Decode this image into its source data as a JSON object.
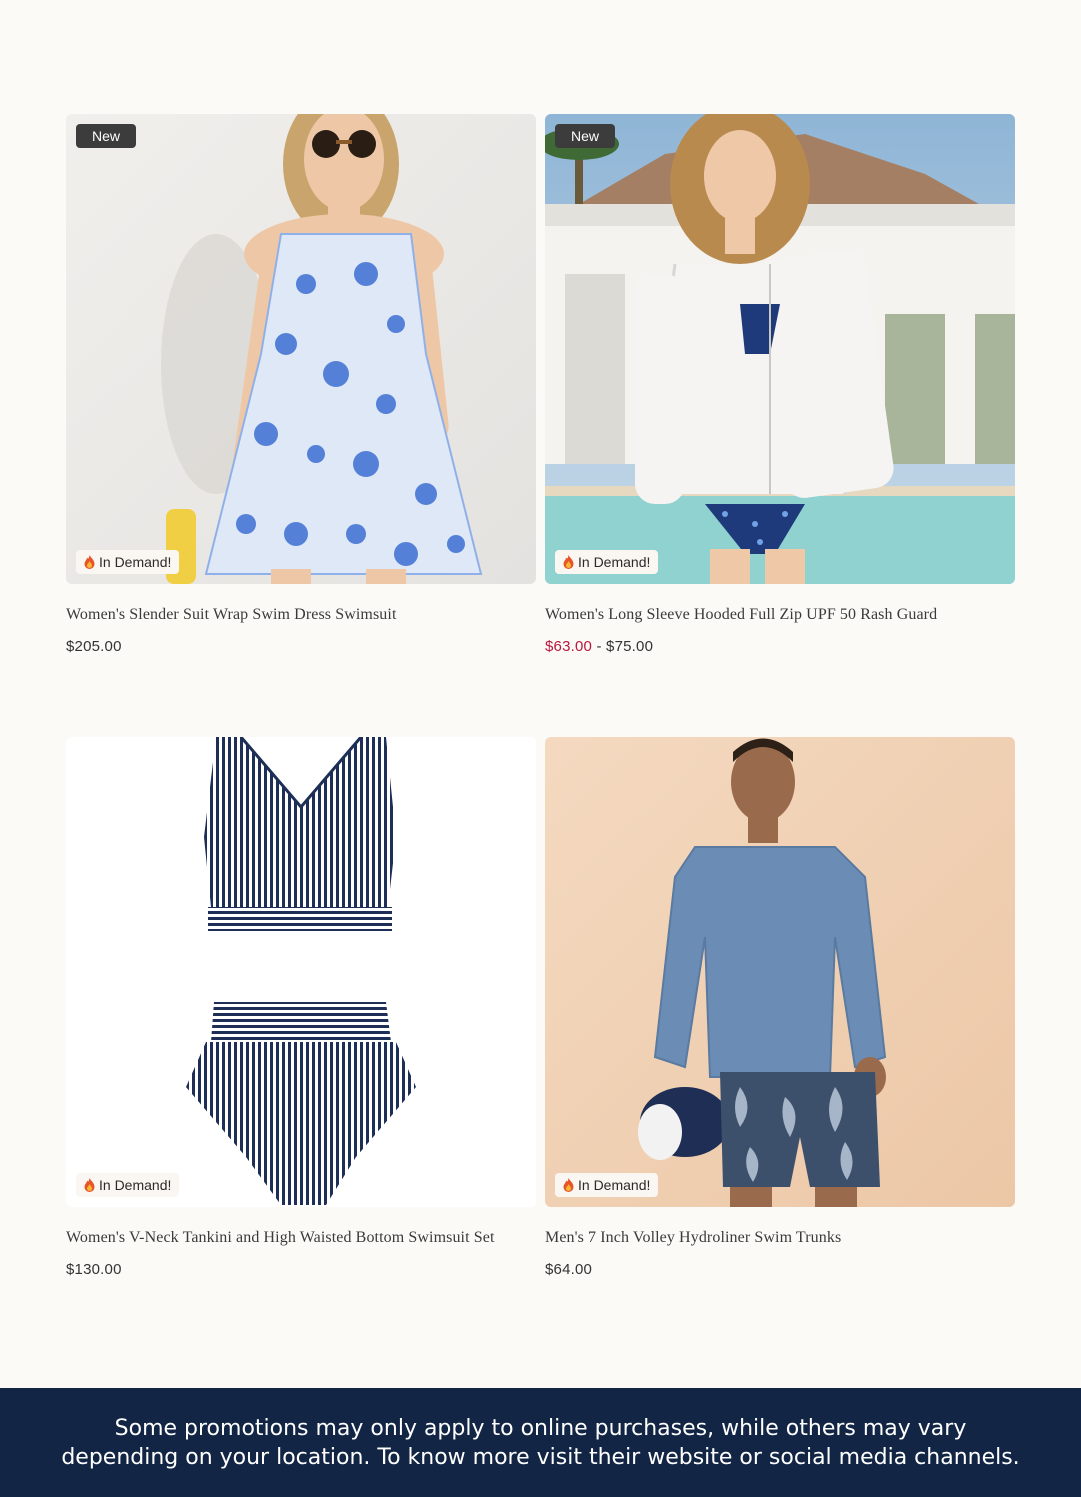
{
  "products": [
    {
      "badge_new": "New",
      "badge_demand": "In Demand!",
      "title": "Women's Slender Suit Wrap Swim Dress Swimsuit",
      "price": "$205.00",
      "image_icon": "model-floral-swim-dress-image"
    },
    {
      "badge_new": "New",
      "badge_demand": "In Demand!",
      "title": "Women's Long Sleeve Hooded Full Zip UPF 50 Rash Guard",
      "price_sale": "$63.00",
      "price_separator": "-",
      "price_regular": "$75.00",
      "image_icon": "model-white-rash-guard-image"
    },
    {
      "badge_demand": "In Demand!",
      "title": "Women's V-Neck Tankini and High Waisted Bottom Swimsuit Set",
      "price": "$130.00",
      "image_icon": "striped-tankini-set-image"
    },
    {
      "badge_demand": "In Demand!",
      "title": "Men's 7 Inch Volley Hydroliner Swim Trunks",
      "price": "$64.00",
      "image_icon": "model-swim-trunks-image"
    }
  ],
  "footer": {
    "notice": "Some promotions may only apply to online purchases, while others may vary depending on your location. To know more visit their website or social media channels."
  },
  "colors": {
    "page_background": "#fbfaf7",
    "sale_price": "#b8173e",
    "footer_background": "#122544",
    "badge_new_background": "#3c3c3c"
  }
}
